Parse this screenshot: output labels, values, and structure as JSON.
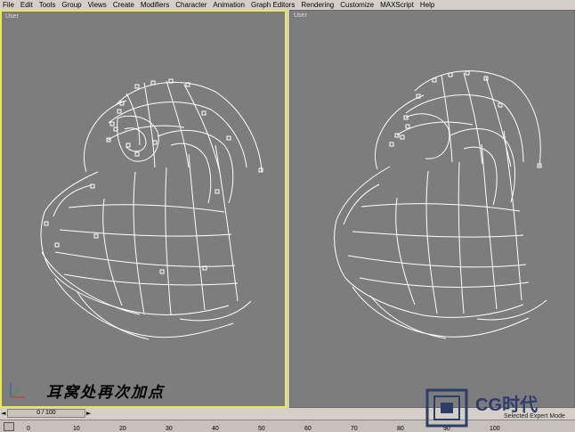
{
  "menu": [
    "File",
    "Edit",
    "Tools",
    "Group",
    "Views",
    "Create",
    "Modifiers",
    "Character",
    "Animation",
    "Graph Editors",
    "Rendering",
    "Customize",
    "MAXScript",
    "Help"
  ],
  "viewports": {
    "left": {
      "label": "User"
    },
    "right": {
      "label": "User"
    }
  },
  "caption": "耳窝处再次加点",
  "timeline": {
    "slider_text": "0 / 100",
    "ticks": [
      "0",
      "10",
      "20",
      "30",
      "40",
      "50",
      "60",
      "70",
      "80",
      "90",
      "100"
    ]
  },
  "logo": {
    "name": "CG时代",
    "sub": "Selected Expert Mode"
  },
  "colors": {
    "active_border": "#e8e85c",
    "viewport_bg": "#7d7d7d",
    "wire": "#ffffff"
  }
}
